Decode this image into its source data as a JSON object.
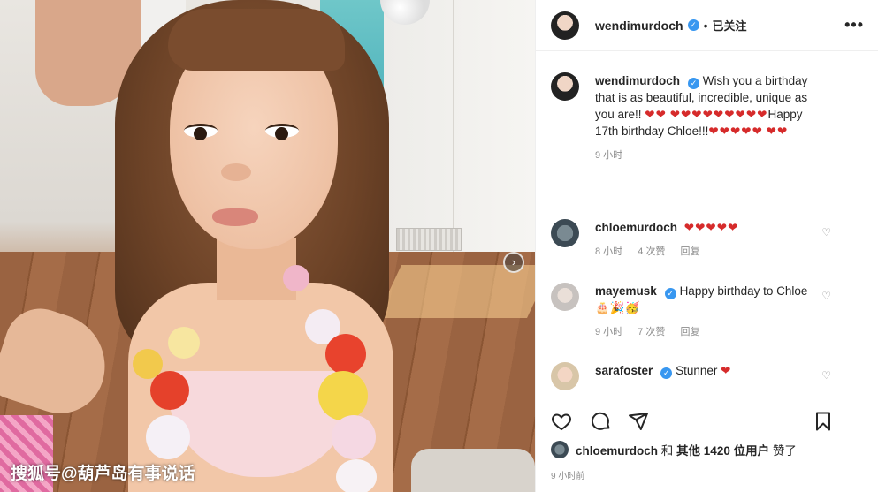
{
  "post": {
    "author": "wendimurdoch",
    "follow_state": "已关注",
    "more_label": "•••",
    "carousel_next": "›"
  },
  "caption": {
    "user": "wendimurdoch",
    "text_part1": "Wish you a birthday that is as beautiful, incredible, unique as you are!!",
    "hearts_a": "❤❤",
    "hearts_b": "❤❤❤❤❤❤❤❤❤",
    "text_part2": "Happy 17th birthday Chloe!!!",
    "hearts_c": "❤❤❤❤❤",
    "hearts_d": "❤❤",
    "time": "9 小时"
  },
  "comments": [
    {
      "user": "chloemurdoch",
      "text": "",
      "hearts": "❤❤❤❤❤",
      "verified": false,
      "time": "8 小时",
      "likes": "4 次赞",
      "reply": "回复"
    },
    {
      "user": "mayemusk",
      "text": "Happy birthday to Chloe",
      "emoji": "🎂🎉🥳",
      "verified": true,
      "time": "9 小时",
      "likes": "7 次赞",
      "reply": "回复"
    },
    {
      "user": "sarafoster",
      "text": "Stunner",
      "hearts": "❤",
      "verified": true
    }
  ],
  "likes": {
    "first_user": "chloemurdoch",
    "conj": "和",
    "others": "其他 1420 位用户",
    "suffix": "赞了"
  },
  "post_time": "9 小时前",
  "watermark": "搜狐号@葫芦岛有事说话",
  "icons": [
    "heart-icon",
    "comment-icon",
    "share-icon",
    "bookmark-icon",
    "verified-icon",
    "more-icon"
  ],
  "colors": {
    "verified": "#3897f0",
    "heart": "#d62b2b",
    "meta": "#8e8e8e"
  }
}
